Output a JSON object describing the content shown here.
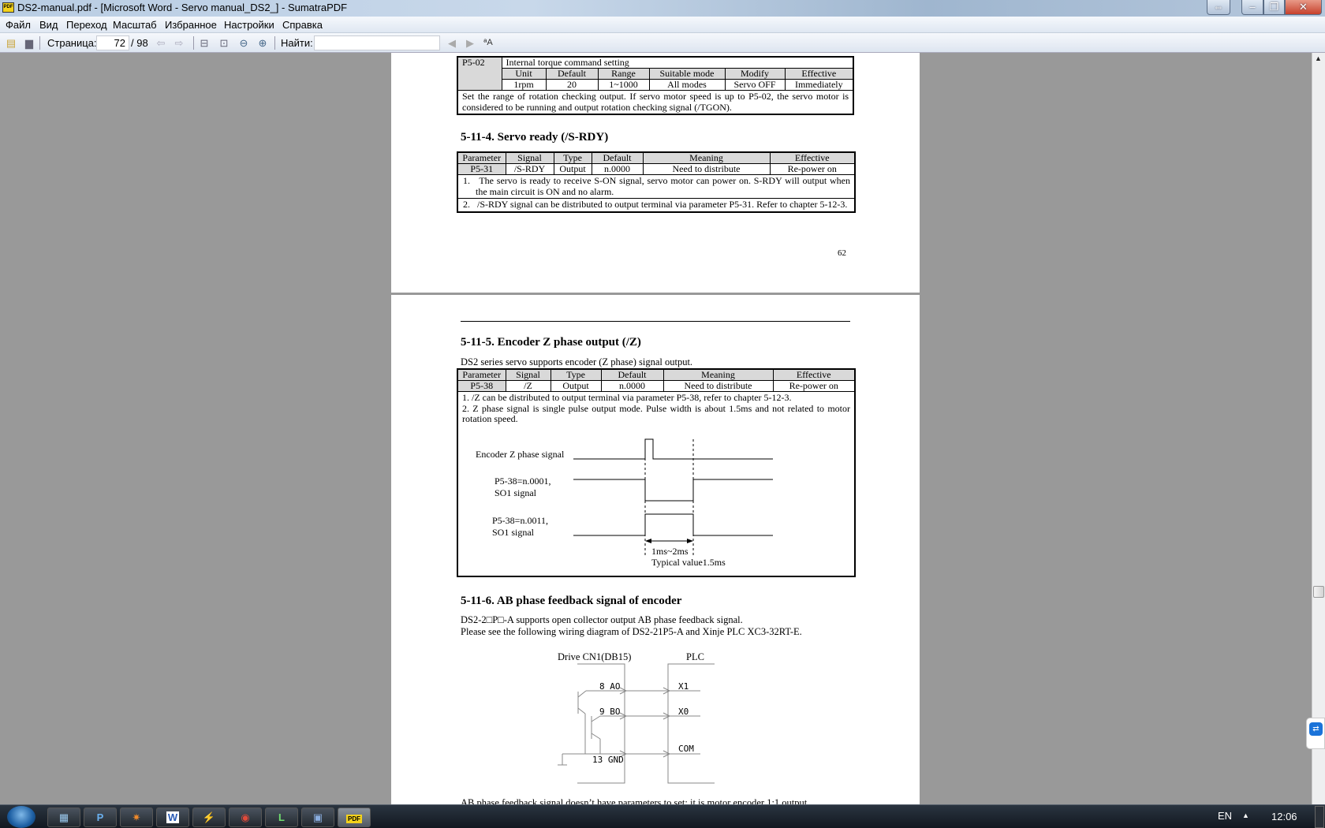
{
  "window": {
    "title": "DS2-manual.pdf - [Microsoft Word - Servo manual_DS2_] - SumatraPDF",
    "app_icon": "PDF"
  },
  "menu": [
    "Файл",
    "Вид",
    "Переход",
    "Масштаб",
    "Избранное",
    "Настройки",
    "Справка"
  ],
  "toolbar": {
    "page_label": "Страница:",
    "page_value": "72",
    "page_total": "/ 98",
    "find_label": "Найти:",
    "find_value": ""
  },
  "page1": {
    "p502": {
      "param": "P5-02",
      "name": "Internal torque command setting",
      "headers": [
        "Unit",
        "Default",
        "Range",
        "Suitable mode",
        "Modify",
        "Effective"
      ],
      "values": [
        "1rpm",
        "20",
        "1~1000",
        "All modes",
        "Servo OFF",
        "Immediately"
      ],
      "desc": "Set the range of rotation checking output. If servo motor speed is up to P5-02, the servo motor is considered to be running and output rotation checking signal (/TGON)."
    },
    "heading": "5-11-4. Servo ready (/S-RDY)",
    "table": {
      "headers": [
        "Parameter",
        "Signal",
        "Type",
        "Default",
        "Meaning",
        "Effective"
      ],
      "values": [
        "P5-31",
        "/S-RDY",
        "Output",
        "n.0000",
        "Need to distribute",
        "Re-power on"
      ],
      "notes": [
        "1.   The servo is ready to receive S-ON signal, servo motor can power on. S-RDY will output when the main circuit is ON and no alarm.",
        "2.   /S-RDY signal can be distributed to output terminal via parameter P5-31. Refer to chapter 5-12-3."
      ]
    },
    "page_number": "62"
  },
  "page2": {
    "heading1": "5-11-5. Encoder Z phase output (/Z)",
    "intro1": "DS2 series servo supports encoder (Z phase) signal output.",
    "table": {
      "headers": [
        "Parameter",
        "Signal",
        "Type",
        "Default",
        "Meaning",
        "Effective"
      ],
      "values": [
        "P5-38",
        "/Z",
        "Output",
        "n.0000",
        "Need to distribute",
        "Re-power on"
      ],
      "notes": [
        "1. /Z can be distributed to output terminal via parameter P5-38, refer to chapter 5-12-3.",
        "2. Z phase signal is single pulse output mode. Pulse width is about 1.5ms and not related to motor rotation speed."
      ]
    },
    "timing": {
      "sig1": "Encoder Z phase signal",
      "sig2a": "P5-38=n.0001,",
      "sig2b": "SO1 signal",
      "sig3a": "P5-38=n.0011,",
      "sig3b": "SO1 signal",
      "range": "1ms~2ms",
      "typical": "Typical value1.5ms"
    },
    "heading2": "5-11-6. AB phase feedback signal of encoder",
    "intro2a": "DS2-2□P□-A supports open collector output AB phase feedback signal.",
    "intro2b": "Please see the following wiring diagram of DS2-21P5-A and Xinje PLC XC3-32RT-E.",
    "wiring": {
      "drive": "Drive CN1(DB15)",
      "plc": "PLC",
      "ao": "8  AO",
      "bo": "9  BO",
      "gnd": "13  GND",
      "x1": "X1",
      "x0": "X0",
      "com": "COM"
    },
    "bottom": "AB phase feedback signal doesn’t have parameters to set; it is motor encoder 1:1 output."
  },
  "taskbar": {
    "apps": [
      "calculator",
      "paint",
      "media",
      "word",
      "tool",
      "chrome",
      "app",
      "remote",
      "sumatrapdf"
    ],
    "lang": "EN",
    "time": "12:06"
  }
}
